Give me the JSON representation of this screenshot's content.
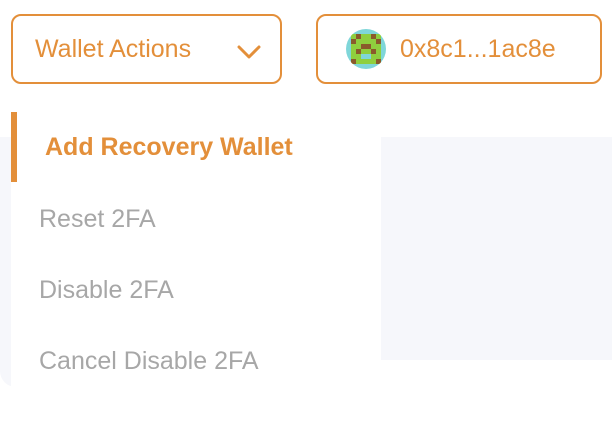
{
  "header": {
    "wallet_actions_label": "Wallet Actions",
    "address_label": "0x8c1...1ac8e"
  },
  "dropdown": {
    "items": [
      {
        "label": "Add Recovery Wallet",
        "active": true
      },
      {
        "label": "Reset 2FA",
        "active": false
      },
      {
        "label": "Disable 2FA",
        "active": false
      },
      {
        "label": "Cancel Disable 2FA",
        "active": false
      }
    ]
  },
  "icons": {
    "wallet_actions_chevron": "chevron-down-icon",
    "address_avatar": "identicon-avatar"
  },
  "colors": {
    "accent": "#e38f3a",
    "muted_text": "#a7a7a7",
    "avatar_green": "#8fcf3e",
    "avatar_brown": "#8a5a2b",
    "avatar_cyan": "#7fd6d9"
  }
}
